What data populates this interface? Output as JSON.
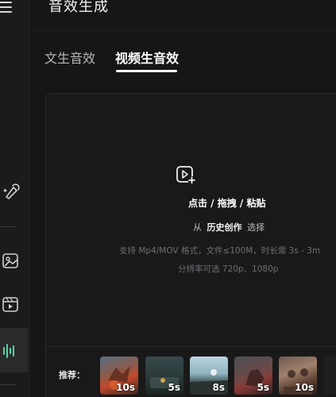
{
  "header": {
    "title": "音效生成"
  },
  "tabs": [
    {
      "label": "文生音效",
      "active": false
    },
    {
      "label": "视频生音效",
      "active": true
    }
  ],
  "upload": {
    "title": "点击 / 拖拽 / 粘贴",
    "history_prefix": "从",
    "history_link": "历史创作",
    "history_suffix": "选择",
    "spec": "支持 Mp4/MOV 格式，文件≤100M，时长需 3s - 3m",
    "resolution": "分辨率可选 720p、1080p"
  },
  "recommend": {
    "label": "推荐：",
    "items": [
      {
        "duration": "10s"
      },
      {
        "duration": "5s"
      },
      {
        "duration": "8s"
      },
      {
        "duration": "5s"
      },
      {
        "duration": "10s"
      }
    ]
  },
  "icons": {
    "menu": "hamburger-menu-icon",
    "tool1": "magic-brush-icon",
    "tool2": "image-icon",
    "tool3": "video-icon",
    "tool4": "audio-wave-icon",
    "upload": "video-upload-icon"
  },
  "colors": {
    "background": "#161617",
    "active_tab": "#ffffff",
    "muted_text": "#6f6f74",
    "active_wave": "#4ed6a0"
  }
}
